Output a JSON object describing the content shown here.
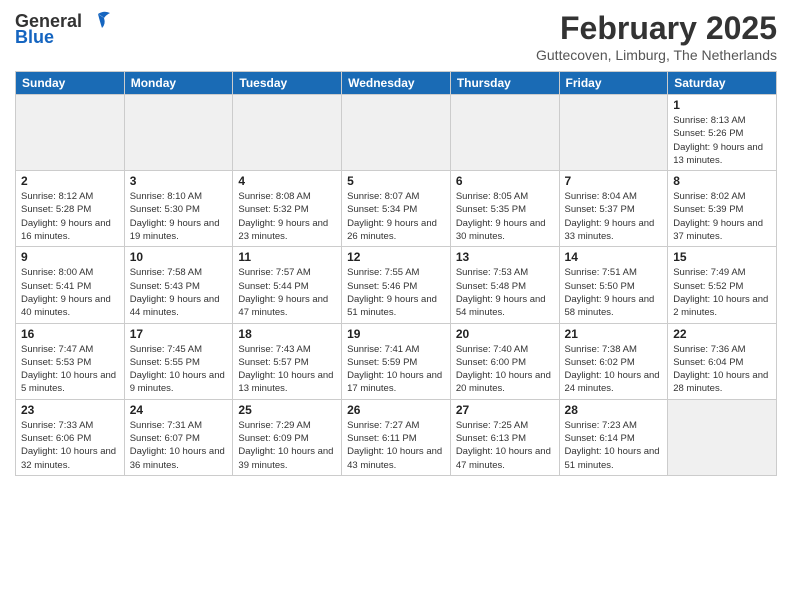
{
  "header": {
    "logo_general": "General",
    "logo_blue": "Blue",
    "main_title": "February 2025",
    "sub_title": "Guttecoven, Limburg, The Netherlands"
  },
  "days_of_week": [
    "Sunday",
    "Monday",
    "Tuesday",
    "Wednesday",
    "Thursday",
    "Friday",
    "Saturday"
  ],
  "weeks": [
    [
      {
        "day": "",
        "info": ""
      },
      {
        "day": "",
        "info": ""
      },
      {
        "day": "",
        "info": ""
      },
      {
        "day": "",
        "info": ""
      },
      {
        "day": "",
        "info": ""
      },
      {
        "day": "",
        "info": ""
      },
      {
        "day": "1",
        "info": "Sunrise: 8:13 AM\nSunset: 5:26 PM\nDaylight: 9 hours and 13 minutes."
      }
    ],
    [
      {
        "day": "2",
        "info": "Sunrise: 8:12 AM\nSunset: 5:28 PM\nDaylight: 9 hours and 16 minutes."
      },
      {
        "day": "3",
        "info": "Sunrise: 8:10 AM\nSunset: 5:30 PM\nDaylight: 9 hours and 19 minutes."
      },
      {
        "day": "4",
        "info": "Sunrise: 8:08 AM\nSunset: 5:32 PM\nDaylight: 9 hours and 23 minutes."
      },
      {
        "day": "5",
        "info": "Sunrise: 8:07 AM\nSunset: 5:34 PM\nDaylight: 9 hours and 26 minutes."
      },
      {
        "day": "6",
        "info": "Sunrise: 8:05 AM\nSunset: 5:35 PM\nDaylight: 9 hours and 30 minutes."
      },
      {
        "day": "7",
        "info": "Sunrise: 8:04 AM\nSunset: 5:37 PM\nDaylight: 9 hours and 33 minutes."
      },
      {
        "day": "8",
        "info": "Sunrise: 8:02 AM\nSunset: 5:39 PM\nDaylight: 9 hours and 37 minutes."
      }
    ],
    [
      {
        "day": "9",
        "info": "Sunrise: 8:00 AM\nSunset: 5:41 PM\nDaylight: 9 hours and 40 minutes."
      },
      {
        "day": "10",
        "info": "Sunrise: 7:58 AM\nSunset: 5:43 PM\nDaylight: 9 hours and 44 minutes."
      },
      {
        "day": "11",
        "info": "Sunrise: 7:57 AM\nSunset: 5:44 PM\nDaylight: 9 hours and 47 minutes."
      },
      {
        "day": "12",
        "info": "Sunrise: 7:55 AM\nSunset: 5:46 PM\nDaylight: 9 hours and 51 minutes."
      },
      {
        "day": "13",
        "info": "Sunrise: 7:53 AM\nSunset: 5:48 PM\nDaylight: 9 hours and 54 minutes."
      },
      {
        "day": "14",
        "info": "Sunrise: 7:51 AM\nSunset: 5:50 PM\nDaylight: 9 hours and 58 minutes."
      },
      {
        "day": "15",
        "info": "Sunrise: 7:49 AM\nSunset: 5:52 PM\nDaylight: 10 hours and 2 minutes."
      }
    ],
    [
      {
        "day": "16",
        "info": "Sunrise: 7:47 AM\nSunset: 5:53 PM\nDaylight: 10 hours and 5 minutes."
      },
      {
        "day": "17",
        "info": "Sunrise: 7:45 AM\nSunset: 5:55 PM\nDaylight: 10 hours and 9 minutes."
      },
      {
        "day": "18",
        "info": "Sunrise: 7:43 AM\nSunset: 5:57 PM\nDaylight: 10 hours and 13 minutes."
      },
      {
        "day": "19",
        "info": "Sunrise: 7:41 AM\nSunset: 5:59 PM\nDaylight: 10 hours and 17 minutes."
      },
      {
        "day": "20",
        "info": "Sunrise: 7:40 AM\nSunset: 6:00 PM\nDaylight: 10 hours and 20 minutes."
      },
      {
        "day": "21",
        "info": "Sunrise: 7:38 AM\nSunset: 6:02 PM\nDaylight: 10 hours and 24 minutes."
      },
      {
        "day": "22",
        "info": "Sunrise: 7:36 AM\nSunset: 6:04 PM\nDaylight: 10 hours and 28 minutes."
      }
    ],
    [
      {
        "day": "23",
        "info": "Sunrise: 7:33 AM\nSunset: 6:06 PM\nDaylight: 10 hours and 32 minutes."
      },
      {
        "day": "24",
        "info": "Sunrise: 7:31 AM\nSunset: 6:07 PM\nDaylight: 10 hours and 36 minutes."
      },
      {
        "day": "25",
        "info": "Sunrise: 7:29 AM\nSunset: 6:09 PM\nDaylight: 10 hours and 39 minutes."
      },
      {
        "day": "26",
        "info": "Sunrise: 7:27 AM\nSunset: 6:11 PM\nDaylight: 10 hours and 43 minutes."
      },
      {
        "day": "27",
        "info": "Sunrise: 7:25 AM\nSunset: 6:13 PM\nDaylight: 10 hours and 47 minutes."
      },
      {
        "day": "28",
        "info": "Sunrise: 7:23 AM\nSunset: 6:14 PM\nDaylight: 10 hours and 51 minutes."
      },
      {
        "day": "",
        "info": ""
      }
    ]
  ]
}
